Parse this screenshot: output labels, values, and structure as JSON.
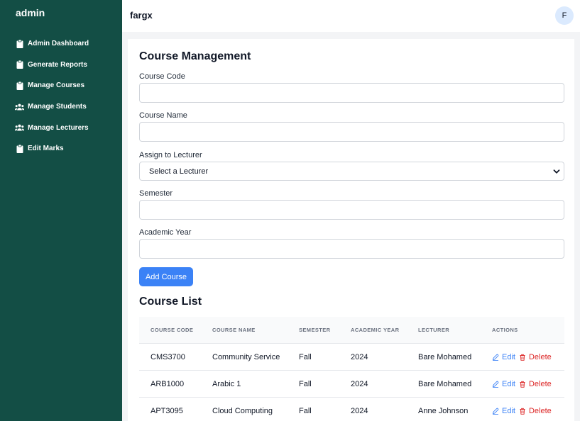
{
  "sidebar": {
    "brand": "admin",
    "items": [
      {
        "label": "Admin Dashboard",
        "icon": "clipboard-icon"
      },
      {
        "label": "Generate Reports",
        "icon": "clipboard-icon"
      },
      {
        "label": "Manage Courses",
        "icon": "clipboard-icon"
      },
      {
        "label": "Manage Students",
        "icon": "users-icon"
      },
      {
        "label": "Manage Lecturers",
        "icon": "users-icon"
      },
      {
        "label": "Edit Marks",
        "icon": "clipboard-icon"
      }
    ]
  },
  "header": {
    "title": "fargx",
    "avatar_initial": "F"
  },
  "form": {
    "title": "Course Management",
    "fields": {
      "course_code": {
        "label": "Course Code",
        "value": ""
      },
      "course_name": {
        "label": "Course Name",
        "value": ""
      },
      "lecturer": {
        "label": "Assign to Lecturer",
        "selected": "Select a Lecturer"
      },
      "semester": {
        "label": "Semester",
        "value": ""
      },
      "academic_year": {
        "label": "Academic Year",
        "value": ""
      }
    },
    "submit_label": "Add Course"
  },
  "course_list": {
    "title": "Course List",
    "columns": [
      "COURSE CODE",
      "COURSE NAME",
      "SEMESTER",
      "ACADEMIC YEAR",
      "LECTURER",
      "ACTIONS"
    ],
    "edit_label": "Edit",
    "delete_label": "Delete",
    "rows": [
      {
        "code": "CMS3700",
        "name": "Community Service",
        "semester": "Fall",
        "year": "2024",
        "lecturer": "Bare Mohamed"
      },
      {
        "code": "ARB1000",
        "name": "Arabic 1",
        "semester": "Fall",
        "year": "2024",
        "lecturer": "Bare Mohamed"
      },
      {
        "code": "APT3095",
        "name": "Cloud Computing",
        "semester": "Fall",
        "year": "2024",
        "lecturer": "Anne Johnson"
      }
    ]
  },
  "colors": {
    "sidebar_bg": "#134e45",
    "accent": "#3b82f6",
    "danger": "#dc2626"
  }
}
